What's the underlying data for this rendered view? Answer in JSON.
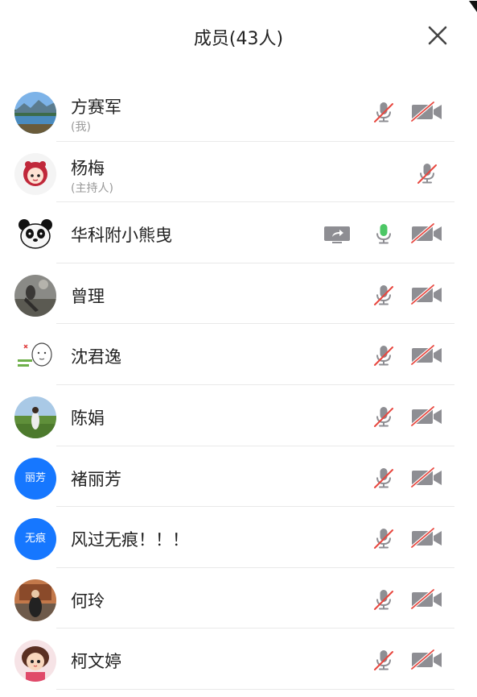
{
  "header": {
    "title": "成员(43人)"
  },
  "members": [
    {
      "name": "方赛军",
      "role": "(我)",
      "avatar": "landscape",
      "mic": "muted",
      "camera": "off"
    },
    {
      "name": "杨梅",
      "role": "(主持人)",
      "avatar": "cartoon-girl",
      "mic": "muted",
      "camera": "none"
    },
    {
      "name": "华科附小熊曳",
      "role": "",
      "avatar": "panda",
      "mic": "active",
      "camera": "off",
      "sharing": true
    },
    {
      "name": "曾理",
      "role": "",
      "avatar": "photo-dark",
      "mic": "muted",
      "camera": "off"
    },
    {
      "name": "沈君逸",
      "role": "",
      "avatar": "doodle",
      "mic": "muted",
      "camera": "off"
    },
    {
      "name": "陈娟",
      "role": "",
      "avatar": "photo-field",
      "mic": "muted",
      "camera": "off"
    },
    {
      "name": "褚丽芳",
      "role": "",
      "avatar": "text",
      "avatar_text": "丽芳",
      "mic": "muted",
      "camera": "off"
    },
    {
      "name": "风过无痕！！！",
      "role": "",
      "avatar": "text",
      "avatar_text": "无痕",
      "mic": "muted",
      "camera": "off"
    },
    {
      "name": "何玲",
      "role": "",
      "avatar": "photo-room",
      "mic": "muted",
      "camera": "off"
    },
    {
      "name": "柯文婷",
      "role": "",
      "avatar": "cartoon-doll",
      "mic": "muted",
      "camera": "off"
    }
  ],
  "colors": {
    "accent": "#1677ff",
    "mute_red": "#e8473f",
    "mic_green": "#4cc765",
    "icon_gray": "#8e8e93"
  },
  "icons": {
    "close": "close-icon",
    "mic": "mic-icon",
    "camera": "camera-off-icon",
    "share": "screen-share-icon"
  }
}
